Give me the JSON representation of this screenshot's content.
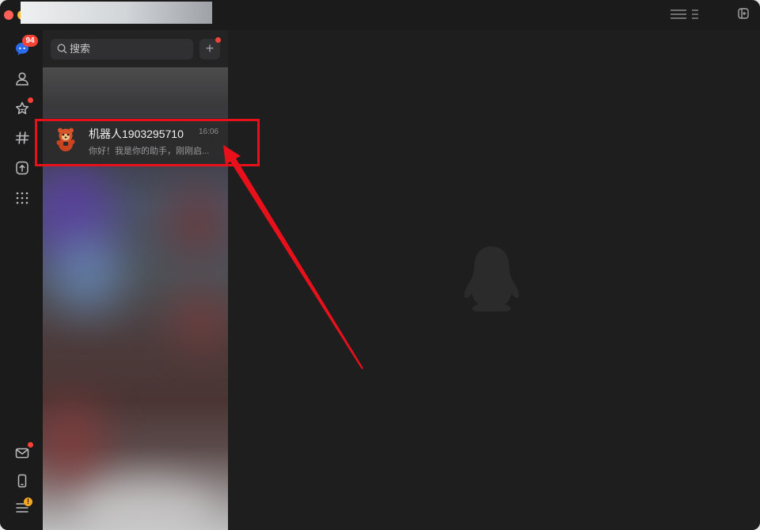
{
  "sidebar": {
    "messages_badge": "94",
    "settings_warning": "!"
  },
  "search": {
    "placeholder": "搜索"
  },
  "chat_list": {
    "items": [
      {
        "name": "机器人1903295710",
        "time": "16:06",
        "preview": "你好！我是你的助手，刚刚启..."
      }
    ]
  },
  "icons": {
    "sidebar": [
      "messages-icon",
      "contacts-icon",
      "favorites-icon",
      "channels-icon",
      "upload-icon",
      "apps-grid-icon",
      "mail-icon",
      "phone-icon",
      "menu-icon"
    ],
    "titlebar": [
      "menu-lines-icon",
      "sidebar-toggle-icon"
    ]
  },
  "colors": {
    "badge": "#f44336",
    "annotation": "#e8101a",
    "warning": "#f5a623"
  }
}
